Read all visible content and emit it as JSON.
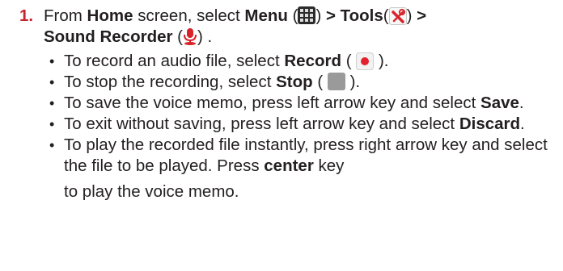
{
  "step": {
    "number": "1.",
    "intro": {
      "t1": "From ",
      "b1": "Home",
      "t2": " screen, select ",
      "b2": "Menu",
      "t3": " (",
      "t4": ") ",
      "b3": "> Tools",
      "t5": "(",
      "t6": ") ",
      "b4": ">",
      "b5": "Sound Recorder",
      "t7": " (",
      "t8": ") ."
    },
    "icons": {
      "menu": "menu-grid-icon",
      "tools": "tools-icon",
      "sound_recorder": "microphone-icon",
      "record": "record-icon",
      "stop": "stop-icon"
    },
    "bullets": {
      "b1": {
        "pre": "To record an audio file, select ",
        "bold": "Record",
        "mid": " (",
        "post": ")."
      },
      "b2": {
        "pre": "To stop the recording, select ",
        "bold": "Stop",
        "mid": " (",
        "post": ")."
      },
      "b3": {
        "pre": "To save the voice memo, press left arrow key and select ",
        "bold": "Save",
        "post": "."
      },
      "b4": {
        "pre": "To exit without saving, press left arrow key and select ",
        "bold": "Discard",
        "post": "."
      },
      "b5": {
        "pre": "To play the recorded file instantly, press right arrow key and select the file to be played. Press ",
        "bold": "center",
        "post": " key",
        "last": "to play the voice memo."
      }
    }
  },
  "colors": {
    "step_number": "#c8242f",
    "text": "#231f20",
    "record_dot": "#e4202e",
    "mic": "#d8232a",
    "stop": "#9a9a9a"
  }
}
